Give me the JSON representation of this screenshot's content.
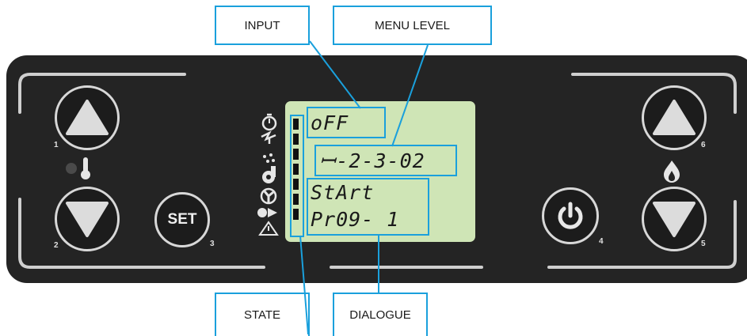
{
  "callouts": {
    "input": "INPUT",
    "menu_level": "MENU LEVEL",
    "state": "STATE",
    "dialogue": "DIALOGUE"
  },
  "display": {
    "line1": "oFF",
    "line2": "ꟷ-2-3-02",
    "line3": "StArt",
    "line4": "Pr09- 1"
  },
  "buttons": {
    "up_left_num": "1",
    "down_left_num": "2",
    "set_label": "SET",
    "set_num": "3",
    "power_num": "4",
    "down_right_num": "5",
    "up_right_num": "6"
  },
  "state_indicator_count": 7,
  "colors": {
    "callout_border": "#1aa0dc",
    "panel": "#242424",
    "lcd": "#cfe5b6",
    "button_ring": "#d8d8d8",
    "led_off": "#4a4a4a"
  },
  "icons": [
    "thermometer-icon",
    "flame-icon",
    "power-icon",
    "triangle-up-icon",
    "triangle-down-icon",
    "warning-icon",
    "fan-icon",
    "pump-icon",
    "spark-icon",
    "timer-icon"
  ]
}
